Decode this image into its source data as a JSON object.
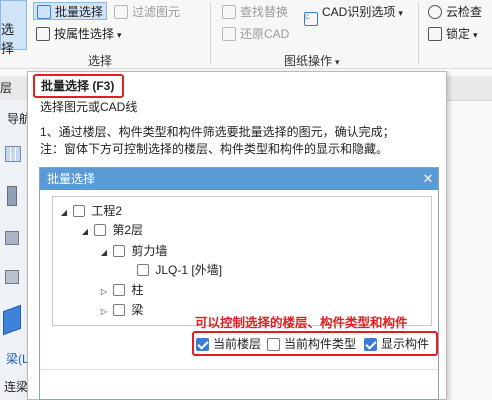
{
  "ribbon": {
    "select_btn_label": "选择",
    "batch_select_label": "批量选择",
    "filter_elements_label": "过滤图元",
    "by_attribute_label": "按属性选择",
    "select_group_label": "选择",
    "find_replace_label": "查找替换",
    "cad_options_label": "CAD识别选项",
    "restore_cad_label": "还原CAD",
    "drawing_ops_label": "图纸操作",
    "cloud_check_label": "云检查",
    "lock_label": "锁定"
  },
  "left": {
    "floor_label": "层",
    "nav_label": "导航",
    "beam_label": "梁(L)",
    "link_beam_label": "连梁("
  },
  "tooltip": {
    "title": "批量选择 (F3)",
    "subtitle": "选择图元或CAD线",
    "desc1": "1、通过楼层、构件类型和构件筛选要批量选择的图元，确认完成；",
    "desc2": "注：窗体下方可控制选择的楼层、构件类型和构件的显示和隐藏。"
  },
  "dialog": {
    "title": "批量选择",
    "close": "✕",
    "tree": [
      {
        "label": "工程2",
        "toggle": "◢"
      },
      {
        "label": "第2层",
        "toggle": "◢"
      },
      {
        "label": "剪力墙",
        "toggle": "◢"
      },
      {
        "label": "JLQ-1 [外墙]",
        "toggle": ""
      },
      {
        "label": "柱",
        "toggle": "▷"
      },
      {
        "label": "梁",
        "toggle": "▷"
      }
    ],
    "annotation": "可以控制选择的楼层、构件类型和构件",
    "options": [
      {
        "label": "当前楼层",
        "checked": true
      },
      {
        "label": "当前构件类型",
        "checked": false
      },
      {
        "label": "显示构件",
        "checked": true
      }
    ]
  },
  "colors": {
    "accent": "#5b9bd5",
    "highlight_red": "#e02020",
    "checkbox_blue": "#3a7bd5"
  }
}
